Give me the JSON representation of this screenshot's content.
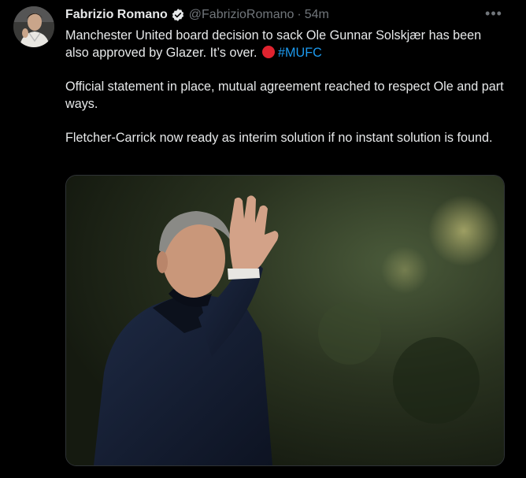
{
  "author": {
    "name": "Fabrizio Romano",
    "handle": "@FabrizioRomano",
    "separator": "·",
    "time": "54m"
  },
  "more_label": "•••",
  "text": {
    "p1_before": "Manchester United board decision to sack Ole Gunnar Solskjær has been also approved by Glazer. It’s over.",
    "p1_hashtag": "#MUFC",
    "p2": "Official statement in place, mutual agreement reached to respect Ole and part ways.",
    "p3": "Fletcher-Carrick now ready as interim solution if no instant solution is found."
  },
  "colors": {
    "background": "#000000",
    "text": "#e7e9ea",
    "muted": "#71767b",
    "link": "#1d9bf0",
    "verified_badge": "#e7e9ea",
    "emoji_red": "#e0232f"
  },
  "icons": {
    "verified": "verified-badge-icon",
    "more": "more-dots-icon",
    "emoji": "red-circle-emoji"
  }
}
